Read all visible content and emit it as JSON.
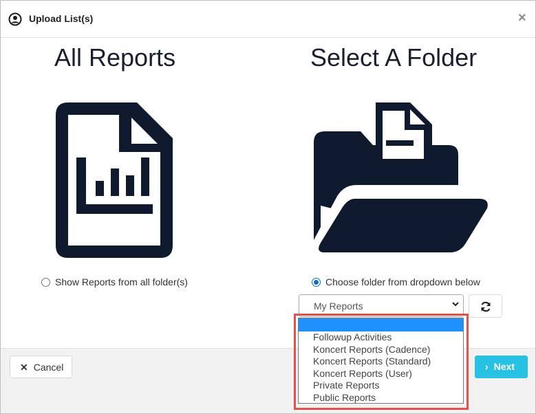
{
  "header": {
    "title": "Upload List(s)",
    "close_label": "×",
    "icon": "user-circle-icon"
  },
  "left_panel": {
    "title": "All Reports",
    "icon": "report-document-icon",
    "radio_label": "Show Reports from all folder(s)",
    "radio_checked": false
  },
  "right_panel": {
    "title": "Select A Folder",
    "icon": "open-folder-icon",
    "radio_label": "Choose folder from dropdown below",
    "radio_checked": true,
    "select_value": "My Reports",
    "refresh_icon": "refresh-icon",
    "dropdown_options": [
      "",
      "Followup Activities",
      "Koncert Reports (Cadence)",
      "Koncert Reports (Standard)",
      "Koncert Reports (User)",
      "Private Reports",
      "Public Reports"
    ]
  },
  "footer": {
    "cancel_label": "Cancel",
    "next_label": "Next"
  },
  "colors": {
    "icon": "#0f1a2e",
    "accent": "#27c1e3",
    "radio": "#0a6ed1",
    "highlight": "#e2514c",
    "option_selected": "#1e90ff"
  }
}
